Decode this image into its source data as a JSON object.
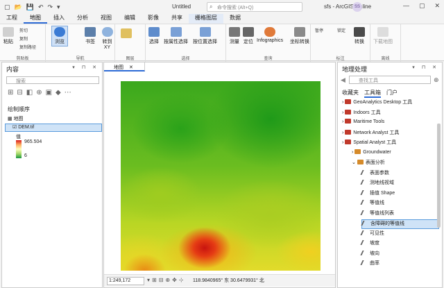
{
  "titlebar": {
    "title": "Untitled",
    "search_placeholder": "命令搜索 (Alt+Q)",
    "project_label": "sfs - ArcGIS Online",
    "user_initials": "SS"
  },
  "tabs": [
    "工程",
    "地图",
    "插入",
    "分析",
    "视图",
    "编辑",
    "影像",
    "共享",
    "栅格图层",
    "数据"
  ],
  "ribbon": {
    "clipboard": {
      "paste": "粘贴",
      "cut": "剪切",
      "copy": "复制",
      "copy_path": "复制路径",
      "group": "剪贴板"
    },
    "navigate": {
      "explore": "浏览",
      "bookmark": "书签",
      "goto": "转到 XY",
      "group": "导航"
    },
    "layer": {
      "group": "图层"
    },
    "selection": {
      "select": "选择",
      "by_attr": "按属性选择",
      "by_loc": "按位置选择",
      "group": "选择"
    },
    "inquiry": {
      "measure": "测量",
      "locate": "定位",
      "infographics": "Infographics",
      "coord": "坐标转换",
      "group": "查询"
    },
    "labeling": {
      "pause": "暂停",
      "lock": "锁定",
      "convert": "转换",
      "group": "标注"
    },
    "offline": {
      "download": "下载地图",
      "group": "离线"
    }
  },
  "contents": {
    "title": "内容",
    "search_placeholder": "搜索",
    "drawing_order": "绘制顺序",
    "map_name": "地图",
    "layer_name": "DEM.tif",
    "value_label": "值",
    "max": "965.504",
    "min": "6"
  },
  "mapview": {
    "tab": "地图",
    "scale": "1:249,172",
    "coords": "118.9840965° 东  30.6479931° 北"
  },
  "geoprocessing": {
    "title": "地理处理",
    "search_placeholder": "查找工具",
    "tabs": [
      "收藏夹",
      "工具箱",
      "门户"
    ],
    "rows": [
      {
        "label": "GeoAnalytics Desktop 工具",
        "kind": "toolbox",
        "indent": 0
      },
      {
        "label": "Indoors 工具",
        "kind": "toolbox",
        "indent": 0
      },
      {
        "label": "Maritime Tools",
        "kind": "toolbox",
        "indent": 0
      },
      {
        "label": "Network Analyst 工具",
        "kind": "toolbox",
        "indent": 0
      },
      {
        "label": "Spatial Analyst 工具",
        "kind": "toolbox",
        "indent": 0
      },
      {
        "label": "Groundwater",
        "kind": "toolset",
        "indent": 1
      },
      {
        "label": "表面分析",
        "kind": "toolset",
        "indent": 1
      },
      {
        "label": "表面参数",
        "kind": "tool",
        "indent": 2
      },
      {
        "label": "测地线视域",
        "kind": "tool",
        "indent": 2
      },
      {
        "label": "插值 Shape",
        "kind": "tool",
        "indent": 2
      },
      {
        "label": "等值线",
        "kind": "tool",
        "indent": 2
      },
      {
        "label": "等值线列表",
        "kind": "tool",
        "indent": 2
      },
      {
        "label": "含障碍的等值线",
        "kind": "tool",
        "indent": 2,
        "selected": true
      },
      {
        "label": "可见性",
        "kind": "tool",
        "indent": 2
      },
      {
        "label": "坡度",
        "kind": "tool",
        "indent": 2
      },
      {
        "label": "坡向",
        "kind": "tool",
        "indent": 2
      },
      {
        "label": "曲率",
        "kind": "tool",
        "indent": 2
      }
    ]
  }
}
